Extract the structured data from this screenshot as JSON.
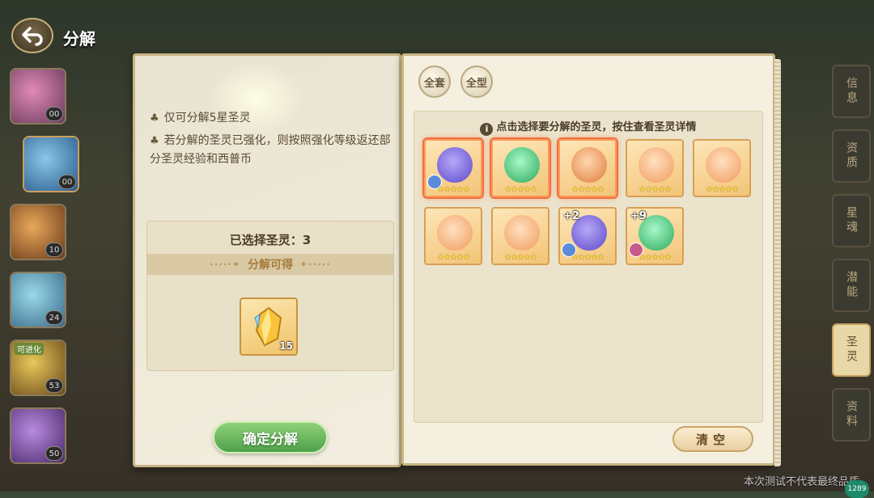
{
  "header": {
    "title": "分解"
  },
  "side_list": [
    {
      "badge": "00",
      "color": "#c86a9a"
    },
    {
      "badge": "00",
      "color": "#5a9ac8"
    },
    {
      "badge": "10",
      "color": "#c8823a"
    },
    {
      "badge": "24",
      "color": "#5ab0c8"
    },
    {
      "badge": "53",
      "tag": "可进化",
      "color": "#c8a03a"
    },
    {
      "badge": "50",
      "color": "#8a5ab0"
    }
  ],
  "right_tabs": [
    {
      "label": "信息",
      "active": false
    },
    {
      "label": "资质",
      "active": false
    },
    {
      "label": "星魂",
      "active": false
    },
    {
      "label": "潜能",
      "active": false
    },
    {
      "label": "圣灵",
      "active": true
    },
    {
      "label": "资料",
      "active": false
    }
  ],
  "left_panel": {
    "rules": [
      "仅可分解5星圣灵",
      "若分解的圣灵已强化，则按照强化等级返还部分圣灵经验和西普币"
    ],
    "selected_label": "已选择圣灵：3",
    "gain_label": "分解可得",
    "reward": {
      "name": "crystal-icon",
      "quantity": "15"
    },
    "confirm_button": "确定分解"
  },
  "right_panel": {
    "filters": [
      {
        "label": "全套"
      },
      {
        "label": "全型"
      }
    ],
    "hint": "点击选择要分解的圣灵，按住查看圣灵详情",
    "cards": [
      {
        "icon": "shield-icon",
        "selected": true,
        "plus": "",
        "owner": "#5a8ad8",
        "art": "#6a5ad8"
      },
      {
        "icon": "eye-icon",
        "selected": true,
        "plus": "",
        "owner": "",
        "art": "#3ac86a"
      },
      {
        "icon": "paw-icon",
        "selected": true,
        "plus": "",
        "owner": "",
        "art": "#e88a4a"
      },
      {
        "icon": "target-icon",
        "selected": false,
        "plus": "",
        "owner": "",
        "art": "#f0a060"
      },
      {
        "icon": "sock-icon",
        "selected": false,
        "plus": "",
        "owner": "",
        "art": "#f0a060"
      },
      {
        "icon": "sock-icon",
        "selected": false,
        "plus": "",
        "owner": "",
        "art": "#f0a060"
      },
      {
        "icon": "card-icon",
        "selected": false,
        "plus": "",
        "owner": "",
        "art": "#f0a060"
      },
      {
        "icon": "paw-icon",
        "selected": false,
        "plus": "+2",
        "owner": "#5a8ad8",
        "art": "#6a5ad8"
      },
      {
        "icon": "heart-icon",
        "selected": false,
        "plus": "+9",
        "owner": "#c85a8a",
        "art": "#3ac86a"
      }
    ],
    "stars": "★★★★★",
    "clear_button": "清空"
  },
  "watermark": "本次测试不代表最终品质",
  "coin_badge": "1289"
}
